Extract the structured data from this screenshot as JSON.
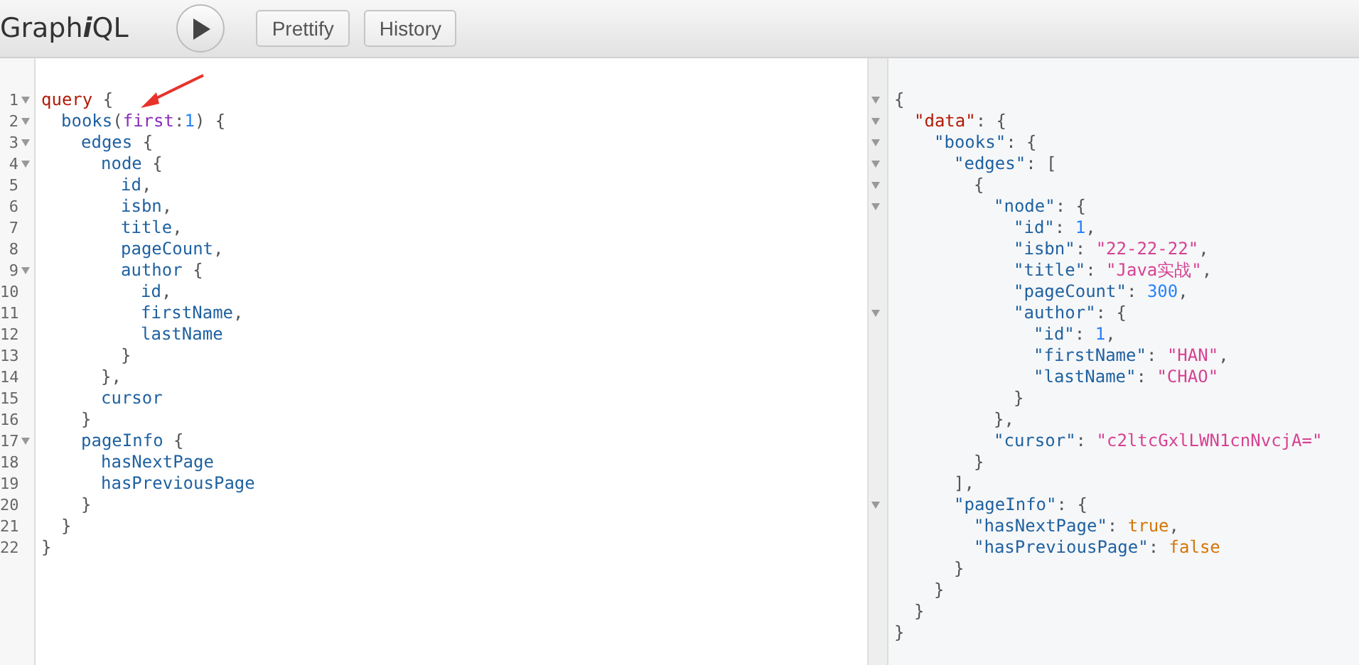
{
  "toolbar": {
    "logo": {
      "parts": [
        {
          "text": "Graph",
          "italic": false
        },
        {
          "text": "i",
          "italic": true
        },
        {
          "text": "QL",
          "italic": false
        }
      ]
    },
    "buttons": [
      "Prettify",
      "History"
    ]
  },
  "query_editor": {
    "lines": [
      {
        "number": "1",
        "foldable": true,
        "tokens": [
          {
            "kind": "keyword",
            "text": "query"
          },
          {
            "kind": "punct",
            "text": " {"
          }
        ],
        "children": [
          {
            "number": "2",
            "foldable": true,
            "tokens": [
              {
                "kind": "field",
                "text": "books"
              },
              {
                "kind": "punct",
                "text": "("
              },
              {
                "kind": "arg",
                "text": "first"
              },
              {
                "kind": "punct",
                "text": ":"
              },
              {
                "kind": "number",
                "text": "1"
              },
              {
                "kind": "punct",
                "text": ") {"
              }
            ],
            "children": [
              {
                "number": "3",
                "foldable": true,
                "tokens": [
                  {
                    "kind": "field",
                    "text": "edges"
                  },
                  {
                    "kind": "punct",
                    "text": " {"
                  }
                ],
                "children": [
                  {
                    "number": "4",
                    "foldable": true,
                    "tokens": [
                      {
                        "kind": "field",
                        "text": "node"
                      },
                      {
                        "kind": "punct",
                        "text": " {"
                      }
                    ],
                    "children": [
                      {
                        "number": "5",
                        "foldable": false,
                        "tokens": [
                          {
                            "kind": "field",
                            "text": "id"
                          },
                          {
                            "kind": "punct",
                            "text": ","
                          }
                        ]
                      },
                      {
                        "number": "6",
                        "foldable": false,
                        "tokens": [
                          {
                            "kind": "field",
                            "text": "isbn"
                          },
                          {
                            "kind": "punct",
                            "text": ","
                          }
                        ]
                      },
                      {
                        "number": "7",
                        "foldable": false,
                        "tokens": [
                          {
                            "kind": "field",
                            "text": "title"
                          },
                          {
                            "kind": "punct",
                            "text": ","
                          }
                        ]
                      },
                      {
                        "number": "8",
                        "foldable": false,
                        "tokens": [
                          {
                            "kind": "field",
                            "text": "pageCount"
                          },
                          {
                            "kind": "punct",
                            "text": ","
                          }
                        ]
                      },
                      {
                        "number": "9",
                        "foldable": true,
                        "tokens": [
                          {
                            "kind": "field",
                            "text": "author"
                          },
                          {
                            "kind": "punct",
                            "text": " {"
                          }
                        ],
                        "children": [
                          {
                            "number": "10",
                            "foldable": false,
                            "tokens": [
                              {
                                "kind": "field",
                                "text": "id"
                              },
                              {
                                "kind": "punct",
                                "text": ","
                              }
                            ]
                          },
                          {
                            "number": "11",
                            "foldable": false,
                            "tokens": [
                              {
                                "kind": "field",
                                "text": "firstName"
                              },
                              {
                                "kind": "punct",
                                "text": ","
                              }
                            ]
                          },
                          {
                            "number": "12",
                            "foldable": false,
                            "tokens": [
                              {
                                "kind": "field",
                                "text": "lastName"
                              }
                            ]
                          }
                        ]
                      },
                      {
                        "number": "13",
                        "foldable": false,
                        "tokens": [
                          {
                            "kind": "punct",
                            "text": "}"
                          }
                        ]
                      }
                    ]
                  },
                  {
                    "number": "14",
                    "foldable": false,
                    "tokens": [
                      {
                        "kind": "punct",
                        "text": "},"
                      }
                    ]
                  },
                  {
                    "number": "15",
                    "foldable": false,
                    "tokens": [
                      {
                        "kind": "field",
                        "text": "cursor"
                      }
                    ]
                  }
                ]
              },
              {
                "number": "16",
                "foldable": false,
                "tokens": [
                  {
                    "kind": "punct",
                    "text": "}"
                  }
                ]
              },
              {
                "number": "17",
                "foldable": true,
                "tokens": [
                  {
                    "kind": "field",
                    "text": "pageInfo"
                  },
                  {
                    "kind": "punct",
                    "text": " {"
                  }
                ],
                "children": [
                  {
                    "number": "18",
                    "foldable": false,
                    "tokens": [
                      {
                        "kind": "field",
                        "text": "hasNextPage"
                      }
                    ]
                  },
                  {
                    "number": "19",
                    "foldable": false,
                    "tokens": [
                      {
                        "kind": "field",
                        "text": "hasPreviousPage"
                      }
                    ]
                  }
                ]
              },
              {
                "number": "20",
                "foldable": false,
                "tokens": [
                  {
                    "kind": "punct",
                    "text": "}"
                  }
                ]
              }
            ]
          },
          {
            "number": "21",
            "foldable": false,
            "tokens": [
              {
                "kind": "punct",
                "text": "}"
              }
            ]
          }
        ]
      },
      {
        "number": "22",
        "foldable": false,
        "tokens": [
          {
            "kind": "punct",
            "text": "}"
          }
        ]
      }
    ]
  },
  "result_viewer": {
    "lines": [
      {
        "foldable": true,
        "tokens": [
          {
            "kind": "punct",
            "text": "{"
          }
        ],
        "children": [
          {
            "foldable": true,
            "tokens": [
              {
                "kind": "keyword",
                "text": "\"data\""
              },
              {
                "kind": "punct",
                "text": ": {"
              }
            ],
            "children": [
              {
                "foldable": true,
                "tokens": [
                  {
                    "kind": "property",
                    "text": "\"books\""
                  },
                  {
                    "kind": "punct",
                    "text": ": {"
                  }
                ],
                "children": [
                  {
                    "foldable": true,
                    "tokens": [
                      {
                        "kind": "property",
                        "text": "\"edges\""
                      },
                      {
                        "kind": "punct",
                        "text": ": ["
                      }
                    ],
                    "children": [
                      {
                        "foldable": true,
                        "tokens": [
                          {
                            "kind": "punct",
                            "text": "{"
                          }
                        ],
                        "children": [
                          {
                            "foldable": true,
                            "tokens": [
                              {
                                "kind": "property",
                                "text": "\"node\""
                              },
                              {
                                "kind": "punct",
                                "text": ": {"
                              }
                            ],
                            "children": [
                              {
                                "foldable": false,
                                "tokens": [
                                  {
                                    "kind": "property",
                                    "text": "\"id\""
                                  },
                                  {
                                    "kind": "punct",
                                    "text": ": "
                                  },
                                  {
                                    "kind": "number",
                                    "text": "1"
                                  },
                                  {
                                    "kind": "punct",
                                    "text": ","
                                  }
                                ]
                              },
                              {
                                "foldable": false,
                                "tokens": [
                                  {
                                    "kind": "property",
                                    "text": "\"isbn\""
                                  },
                                  {
                                    "kind": "punct",
                                    "text": ": "
                                  },
                                  {
                                    "kind": "string",
                                    "text": "\"22-22-22\""
                                  },
                                  {
                                    "kind": "punct",
                                    "text": ","
                                  }
                                ]
                              },
                              {
                                "foldable": false,
                                "tokens": [
                                  {
                                    "kind": "property",
                                    "text": "\"title\""
                                  },
                                  {
                                    "kind": "punct",
                                    "text": ": "
                                  },
                                  {
                                    "kind": "string",
                                    "text": "\"Java实战\""
                                  },
                                  {
                                    "kind": "punct",
                                    "text": ","
                                  }
                                ]
                              },
                              {
                                "foldable": false,
                                "tokens": [
                                  {
                                    "kind": "property",
                                    "text": "\"pageCount\""
                                  },
                                  {
                                    "kind": "punct",
                                    "text": ": "
                                  },
                                  {
                                    "kind": "number",
                                    "text": "300"
                                  },
                                  {
                                    "kind": "punct",
                                    "text": ","
                                  }
                                ]
                              },
                              {
                                "foldable": true,
                                "tokens": [
                                  {
                                    "kind": "property",
                                    "text": "\"author\""
                                  },
                                  {
                                    "kind": "punct",
                                    "text": ": {"
                                  }
                                ],
                                "children": [
                                  {
                                    "foldable": false,
                                    "tokens": [
                                      {
                                        "kind": "property",
                                        "text": "\"id\""
                                      },
                                      {
                                        "kind": "punct",
                                        "text": ": "
                                      },
                                      {
                                        "kind": "number",
                                        "text": "1"
                                      },
                                      {
                                        "kind": "punct",
                                        "text": ","
                                      }
                                    ]
                                  },
                                  {
                                    "foldable": false,
                                    "tokens": [
                                      {
                                        "kind": "property",
                                        "text": "\"firstName\""
                                      },
                                      {
                                        "kind": "punct",
                                        "text": ": "
                                      },
                                      {
                                        "kind": "string",
                                        "text": "\"HAN\""
                                      },
                                      {
                                        "kind": "punct",
                                        "text": ","
                                      }
                                    ]
                                  },
                                  {
                                    "foldable": false,
                                    "tokens": [
                                      {
                                        "kind": "property",
                                        "text": "\"lastName\""
                                      },
                                      {
                                        "kind": "punct",
                                        "text": ": "
                                      },
                                      {
                                        "kind": "string",
                                        "text": "\"CHAO\""
                                      }
                                    ]
                                  }
                                ]
                              },
                              {
                                "foldable": false,
                                "tokens": [
                                  {
                                    "kind": "punct",
                                    "text": "}"
                                  }
                                ]
                              }
                            ]
                          },
                          {
                            "foldable": false,
                            "tokens": [
                              {
                                "kind": "punct",
                                "text": "},"
                              }
                            ]
                          },
                          {
                            "foldable": false,
                            "tokens": [
                              {
                                "kind": "property",
                                "text": "\"cursor\""
                              },
                              {
                                "kind": "punct",
                                "text": ": "
                              },
                              {
                                "kind": "string",
                                "text": "\"c2ltcGxlLWN1cnNvcjA=\""
                              }
                            ]
                          }
                        ]
                      },
                      {
                        "foldable": false,
                        "tokens": [
                          {
                            "kind": "punct",
                            "text": "}"
                          }
                        ]
                      }
                    ]
                  },
                  {
                    "foldable": false,
                    "tokens": [
                      {
                        "kind": "punct",
                        "text": "],"
                      }
                    ]
                  },
                  {
                    "foldable": true,
                    "tokens": [
                      {
                        "kind": "property",
                        "text": "\"pageInfo\""
                      },
                      {
                        "kind": "punct",
                        "text": ": {"
                      }
                    ],
                    "children": [
                      {
                        "foldable": false,
                        "tokens": [
                          {
                            "kind": "property",
                            "text": "\"hasNextPage\""
                          },
                          {
                            "kind": "punct",
                            "text": ": "
                          },
                          {
                            "kind": "boolean",
                            "text": "true"
                          },
                          {
                            "kind": "punct",
                            "text": ","
                          }
                        ]
                      },
                      {
                        "foldable": false,
                        "tokens": [
                          {
                            "kind": "property",
                            "text": "\"hasPreviousPage\""
                          },
                          {
                            "kind": "punct",
                            "text": ": "
                          },
                          {
                            "kind": "boolean",
                            "text": "false"
                          }
                        ]
                      }
                    ]
                  },
                  {
                    "foldable": false,
                    "tokens": [
                      {
                        "kind": "punct",
                        "text": "}"
                      }
                    ]
                  }
                ]
              },
              {
                "foldable": false,
                "tokens": [
                  {
                    "kind": "punct",
                    "text": "}"
                  }
                ]
              }
            ]
          },
          {
            "foldable": false,
            "tokens": [
              {
                "kind": "punct",
                "text": "}"
              }
            ]
          }
        ]
      },
      {
        "foldable": false,
        "tokens": [
          {
            "kind": "punct",
            "text": "}"
          }
        ]
      }
    ]
  }
}
